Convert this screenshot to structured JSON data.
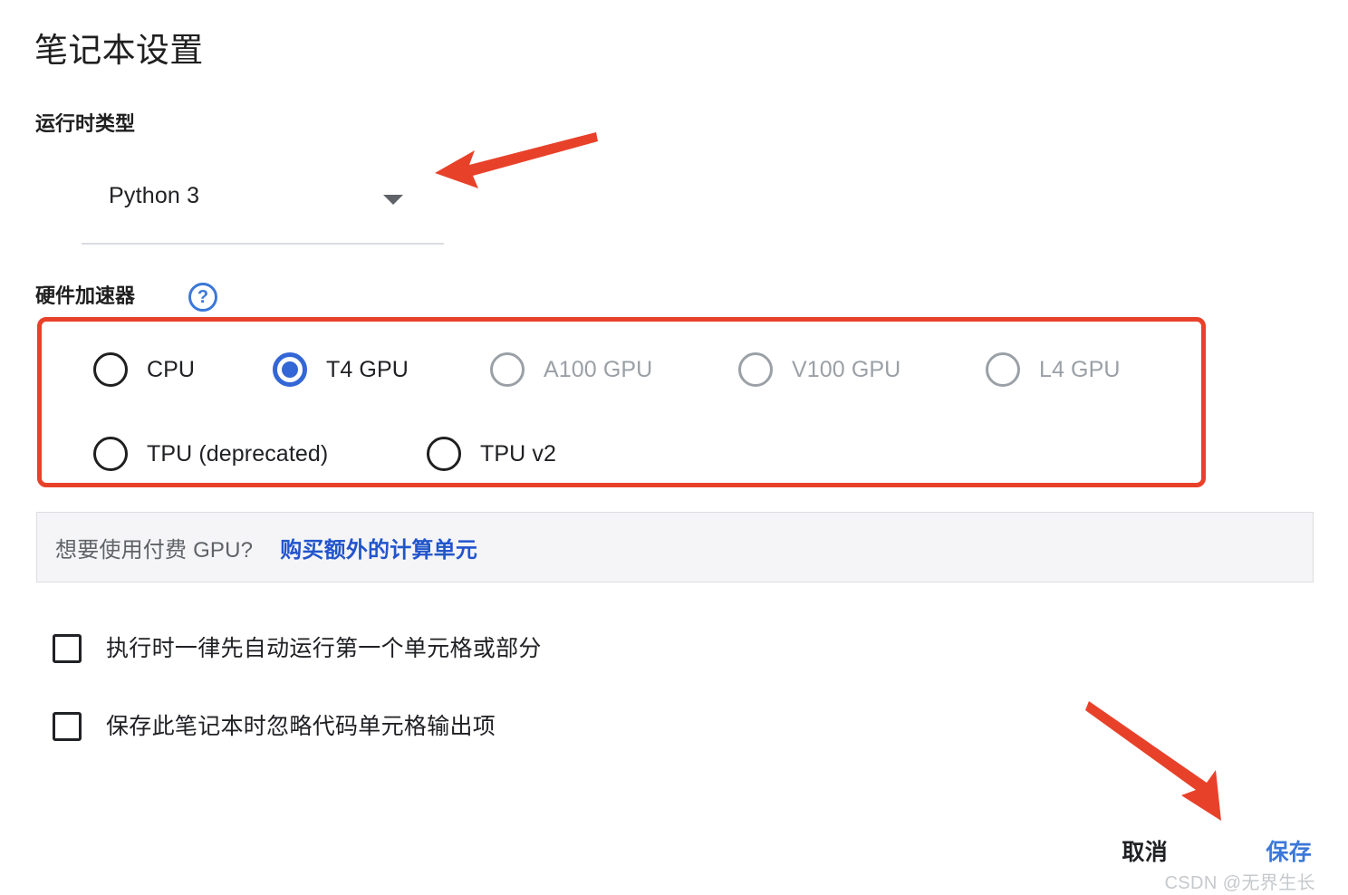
{
  "dialog": {
    "title": "笔记本设置"
  },
  "runtime": {
    "label": "运行时类型",
    "selected": "Python 3",
    "dropdown_icon": "chevron-down-icon"
  },
  "accelerator": {
    "label": "硬件加速器",
    "help_icon_label": "?",
    "options": [
      {
        "label": "CPU",
        "selected": false,
        "disabled": false
      },
      {
        "label": "T4 GPU",
        "selected": true,
        "disabled": false
      },
      {
        "label": "A100 GPU",
        "selected": false,
        "disabled": true
      },
      {
        "label": "V100 GPU",
        "selected": false,
        "disabled": true
      },
      {
        "label": "L4 GPU",
        "selected": false,
        "disabled": true
      },
      {
        "label": "TPU (deprecated)",
        "selected": false,
        "disabled": false
      },
      {
        "label": "TPU v2",
        "selected": false,
        "disabled": false
      }
    ]
  },
  "banner": {
    "text": "想要使用付费 GPU?",
    "link_text": "购买额外的计算单元"
  },
  "checkboxes": [
    {
      "label": "执行时一律先自动运行第一个单元格或部分",
      "checked": false
    },
    {
      "label": "保存此笔记本时忽略代码单元格输出项",
      "checked": false
    }
  ],
  "footer": {
    "cancel_label": "取消",
    "save_label": "保存"
  },
  "watermark": {
    "text": "CSDN @无界生长"
  },
  "colors": {
    "annotation_red": "#e8412a",
    "accent_blue": "#3b78d8",
    "selected_radio_blue": "#3367d6",
    "link_blue": "#2255cc",
    "disabled_grey": "#9aa0a6",
    "banner_bg": "#f5f5f7"
  }
}
